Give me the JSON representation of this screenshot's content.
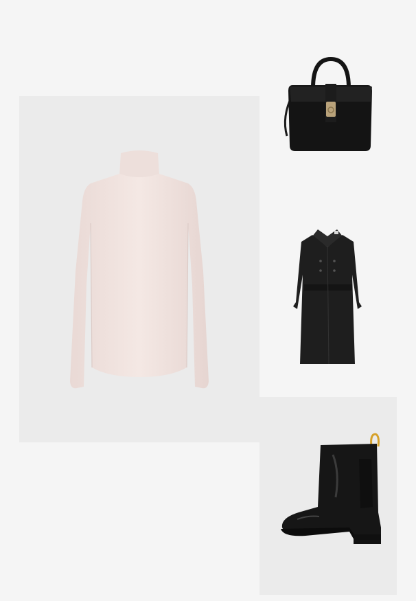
{
  "board": {
    "background": "#f5f5f5",
    "panel_color": "#ebebeb"
  },
  "items": [
    {
      "name": "turtleneck-top",
      "icon": "turtleneck-icon",
      "color": "#f1e3df"
    },
    {
      "name": "handbag",
      "icon": "handbag-icon",
      "color": "#141414",
      "hardware_color": "#b9a27a"
    },
    {
      "name": "trench-coat",
      "icon": "trench-coat-icon",
      "color": "#1e1e1e"
    },
    {
      "name": "ankle-boot",
      "icon": "boot-icon",
      "color": "#161616",
      "pull_tab_color": "#d6a12a"
    }
  ]
}
